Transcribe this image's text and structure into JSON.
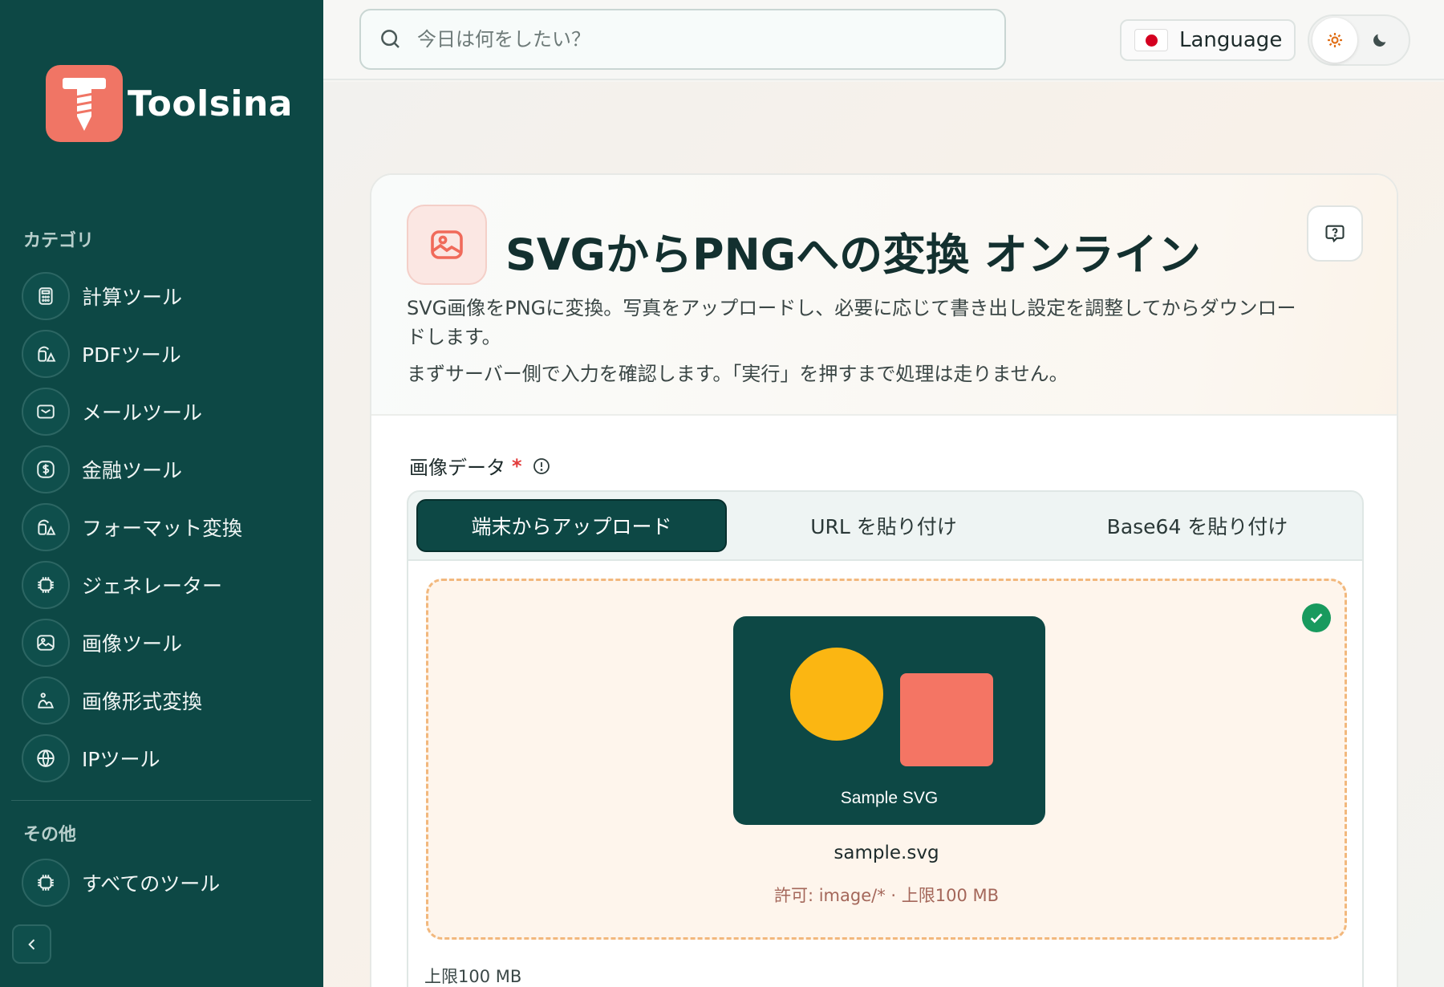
{
  "brand": {
    "name": "Toolsina",
    "logo_icon": "screw-t-logo"
  },
  "sidebar": {
    "categories_label": "カテゴリ",
    "items": [
      {
        "label": "計算ツール",
        "icon": "calculator-icon"
      },
      {
        "label": "PDFツール",
        "icon": "shapes-icon"
      },
      {
        "label": "メールツール",
        "icon": "mail-icon"
      },
      {
        "label": "金融ツール",
        "icon": "dollar-icon"
      },
      {
        "label": "フォーマット変換",
        "icon": "shapes-icon"
      },
      {
        "label": "ジェネレーター",
        "icon": "chip-icon"
      },
      {
        "label": "画像ツール",
        "icon": "image-icon"
      },
      {
        "label": "画像形式変換",
        "icon": "image-convert-icon"
      },
      {
        "label": "IPツール",
        "icon": "globe-icon"
      }
    ],
    "other_label": "その他",
    "all_tools": {
      "label": "すべてのツール",
      "icon": "chip-icon"
    }
  },
  "topbar": {
    "search_placeholder": "今日は何をしたい？",
    "language_label": "Language",
    "theme": {
      "active": "light"
    }
  },
  "tool": {
    "title": "SVGからPNGへの変換 オンライン",
    "description": "SVG画像をPNGに変換。写真をアップロードし、必要に応じて書き出し設定を調整してからダウンロードします。",
    "note": "まずサーバー側で入力を確認します。「実行」を押すまで処理は走りません。",
    "field_label": "画像データ",
    "required_mark": "*",
    "tabs": [
      {
        "label": "端末からアップロード",
        "active": true
      },
      {
        "label": "URL を貼り付け",
        "active": false
      },
      {
        "label": "Base64 を貼り付け",
        "active": false
      }
    ],
    "upload": {
      "preview_caption": "Sample SVG",
      "file_name": "sample.svg",
      "hint": "許可: image/* · 上限100 MB",
      "status": "uploaded"
    },
    "limit_text": "上限100 MB"
  },
  "colors": {
    "sidebar_bg": "#0d4845",
    "accent": "#f07565",
    "preview_circle": "#fbb612",
    "preview_square": "#f47564",
    "success": "#189a5e"
  }
}
